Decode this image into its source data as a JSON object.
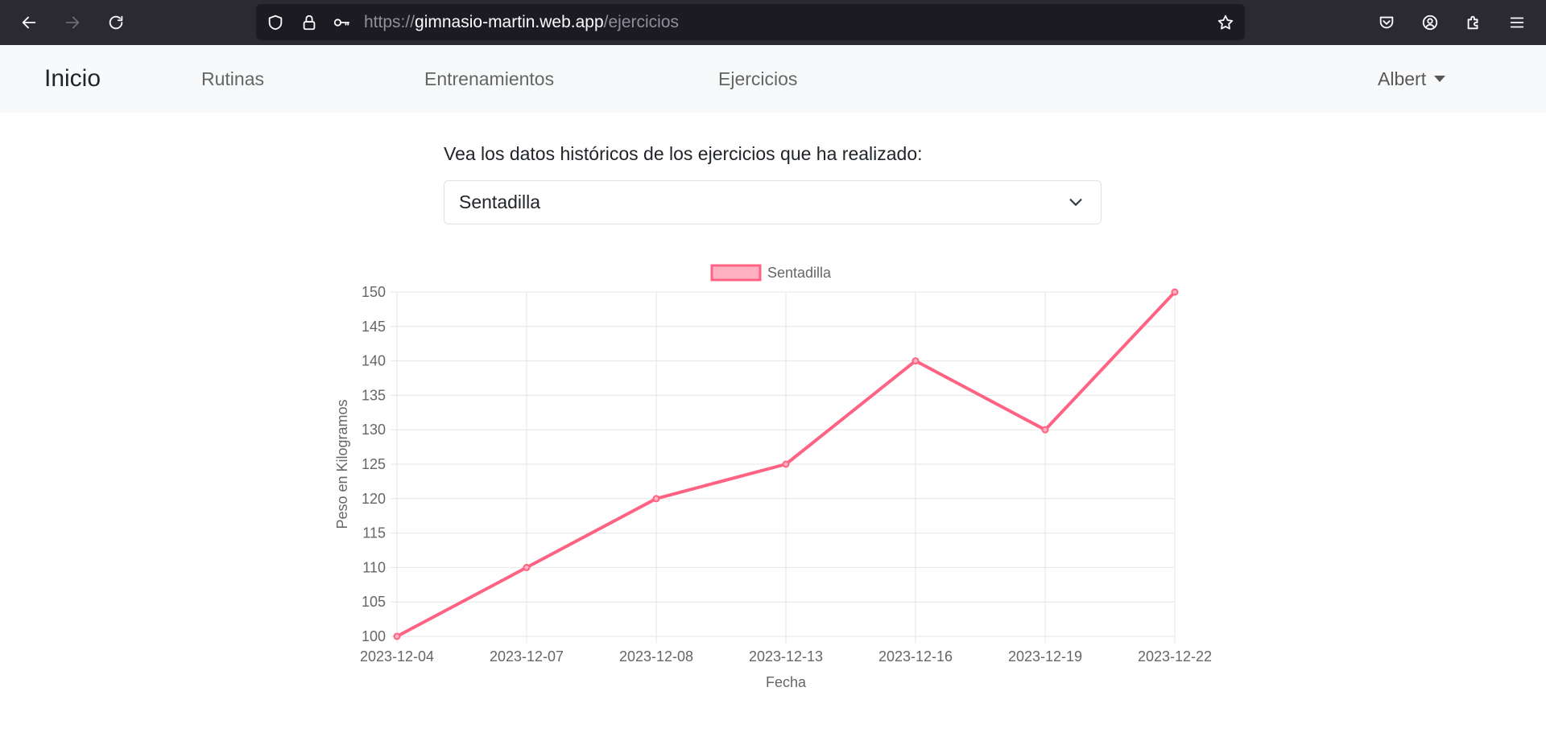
{
  "browser": {
    "url_prefix": "https://",
    "url_domain": "gimnasio-martin.web.app",
    "url_path": "/ejercicios",
    "icons": {
      "back": "back-arrow-icon",
      "forward": "forward-arrow-icon",
      "reload": "reload-icon",
      "shield": "shield-icon",
      "lock": "lock-icon",
      "key": "key-icon",
      "bookmark": "star-icon",
      "pocket": "pocket-icon",
      "account": "account-icon",
      "extensions": "puzzle-icon",
      "menu": "hamburger-menu-icon"
    }
  },
  "navbar": {
    "brand": "Inicio",
    "links": [
      "Rutinas",
      "Entrenamientos",
      "Ejercicios"
    ],
    "user": "Albert"
  },
  "main": {
    "prompt": "Vea los datos históricos de los ejercicios que ha realizado:",
    "selected_exercise": "Sentadilla"
  },
  "chart_data": {
    "type": "line",
    "categories": [
      "2023-12-04",
      "2023-12-07",
      "2023-12-08",
      "2023-12-13",
      "2023-12-16",
      "2023-12-19",
      "2023-12-22"
    ],
    "series": [
      {
        "name": "Sentadilla",
        "values": [
          100,
          110,
          120,
          125,
          140,
          130,
          150
        ]
      }
    ],
    "xlabel": "Fecha",
    "ylabel": "Peso en Kilogramos",
    "ylim": [
      100,
      150
    ],
    "yticks": [
      "100",
      "105",
      "110",
      "115",
      "120",
      "125",
      "130",
      "135",
      "140",
      "145",
      "150"
    ],
    "grid": true,
    "legend": "top-center",
    "colors": {
      "line": "#ff6384",
      "fill": "#ffb1c1",
      "grid": "#e5e5e5",
      "text": "#666666"
    }
  }
}
